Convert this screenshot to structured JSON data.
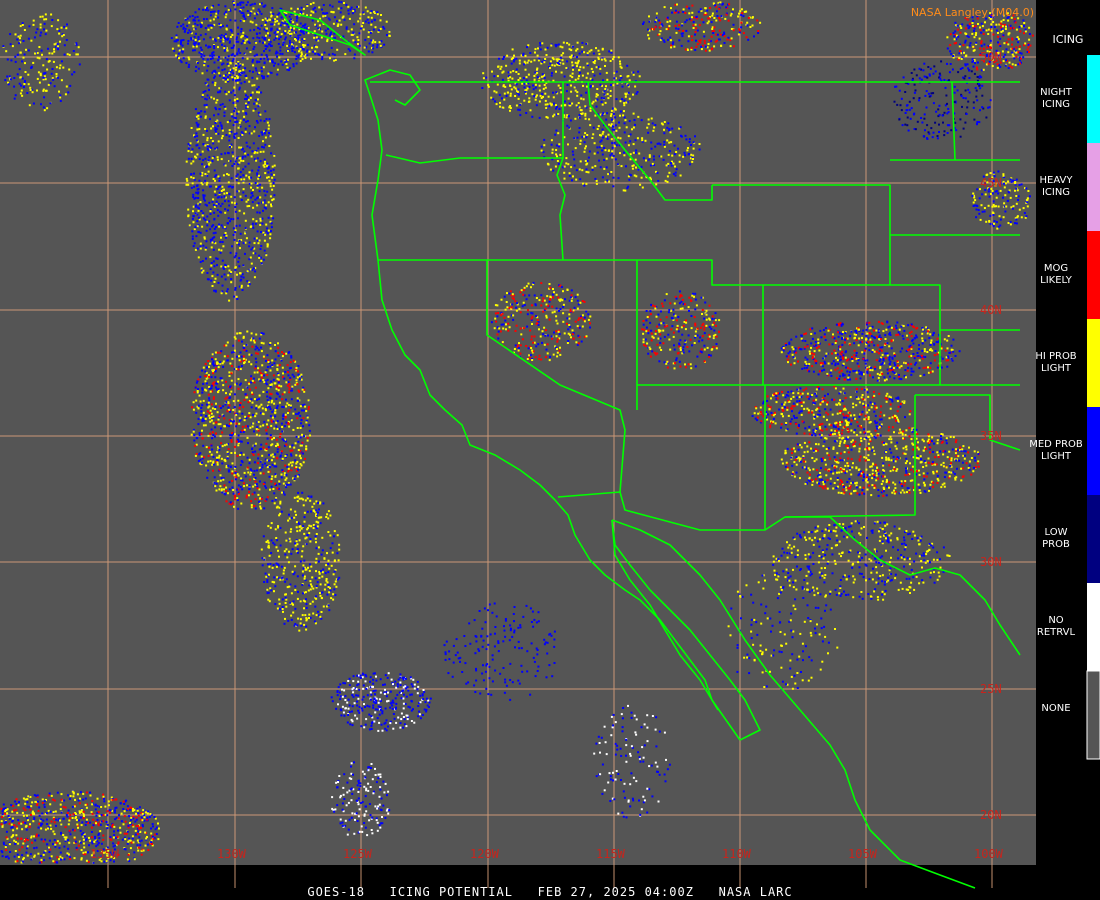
{
  "credit": "NASA Langley (M04.0)",
  "footer": "GOES-18   ICING POTENTIAL   FEB 27, 2025 04:00Z   NASA LARC",
  "legend": {
    "title": "ICING",
    "items": [
      {
        "label": "NIGHT\nICING",
        "color": "#00ffff"
      },
      {
        "label": "HEAVY\nICING",
        "color": "#e6a0e6"
      },
      {
        "label": "MOG\nLIKELY",
        "color": "#ff0000"
      },
      {
        "label": "HI PROB\nLIGHT",
        "color": "#ffff00"
      },
      {
        "label": "MED PROB\nLIGHT",
        "color": "#0000ff"
      },
      {
        "label": "LOW\nPROB",
        "color": "#000080"
      },
      {
        "label": "NO\nRETRVL",
        "color": "#ffffff"
      },
      {
        "label": "NONE",
        "color": "#555555"
      }
    ]
  },
  "longitude_labels": [
    "135W",
    "130W",
    "125W",
    "120W",
    "115W",
    "110W",
    "105W",
    "100W"
  ],
  "latitude_labels": [
    "50N",
    "45N",
    "40N",
    "35N",
    "30N",
    "25N",
    "20N"
  ],
  "colors": {
    "background": "#555555",
    "graticule": "#d9a07a",
    "boundaries": "#00ff00",
    "grid_label": "#c8241c"
  }
}
